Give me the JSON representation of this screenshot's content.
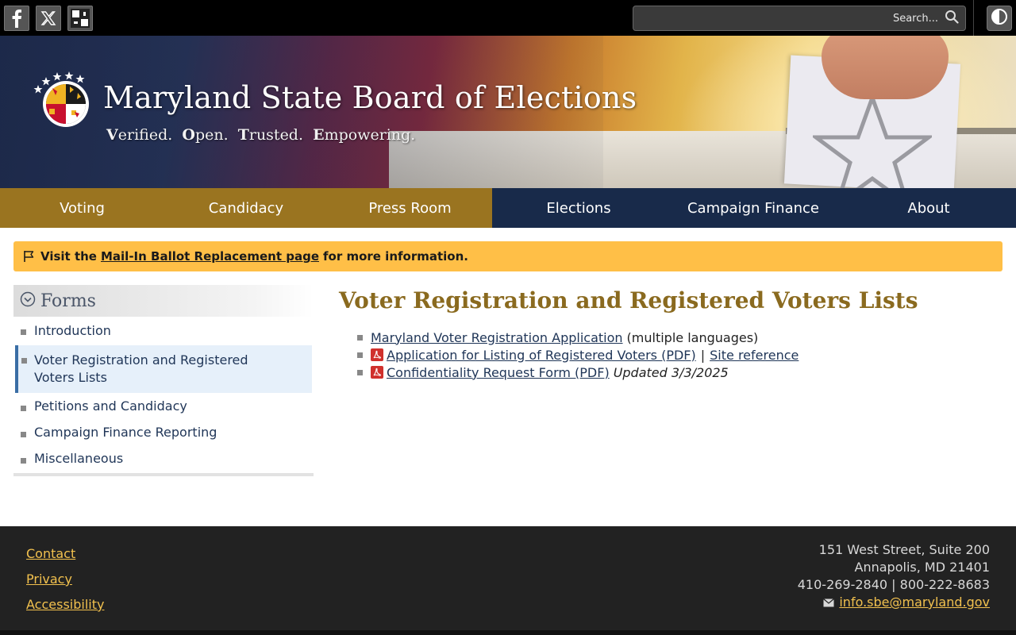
{
  "topbar": {
    "social": [
      "facebook-icon",
      "x-icon",
      "maryland-flag-icon"
    ],
    "search": {
      "placeholder": "Search..."
    },
    "contrast_icon": "contrast-icon"
  },
  "header": {
    "title": "Maryland State Board of Elections",
    "tagline": [
      {
        "initial": "V",
        "rest": "erified."
      },
      {
        "initial": "O",
        "rest": "pen."
      },
      {
        "initial": "T",
        "rest": "rusted."
      },
      {
        "initial": "E",
        "rest": "mpowering."
      }
    ]
  },
  "nav": {
    "items": [
      {
        "label": "Voting",
        "group": "gold"
      },
      {
        "label": "Candidacy",
        "group": "gold"
      },
      {
        "label": "Press Room",
        "group": "gold"
      },
      {
        "label": "Elections",
        "group": "navy"
      },
      {
        "label": "Campaign Finance",
        "group": "navy"
      },
      {
        "label": "About",
        "group": "navy"
      }
    ]
  },
  "alert": {
    "prefix": "Visit the",
    "link": "Mail-In Ballot Replacement page",
    "suffix": "for more information."
  },
  "sidebar": {
    "heading": "Forms",
    "items": [
      {
        "label": "Introduction",
        "active": false
      },
      {
        "label": "Voter Registration and Registered Voters Lists",
        "active": true
      },
      {
        "label": "Petitions and Candidacy",
        "active": false
      },
      {
        "label": "Campaign Finance Reporting",
        "active": false
      },
      {
        "label": "Miscellaneous",
        "active": false
      }
    ]
  },
  "main": {
    "title": "Voter Registration and Registered Voters Lists",
    "documents": [
      {
        "link": "Maryland Voter Registration Application",
        "pdf": false,
        "note": "(multiple languages)"
      },
      {
        "link": "Application for Listing of Registered Voters (PDF)",
        "pdf": true,
        "separator": "|",
        "extra_link": "Site reference"
      },
      {
        "link": "Confidentiality Request Form (PDF)",
        "pdf": true,
        "italic_note": "Updated 3/3/2025"
      }
    ]
  },
  "footer": {
    "links": [
      "Contact",
      "Privacy",
      "Accessibility"
    ],
    "address": [
      "151 West Street, Suite 200",
      "Annapolis, MD 21401",
      "410-269-2840 | 800-222-8683"
    ],
    "email": "info.sbe@maryland.gov"
  },
  "colors": {
    "nav_gold": "#9a7420",
    "nav_navy": "#182a4a",
    "alert_bg": "#ffbf47",
    "title_gold": "#8a6a1f",
    "link_navy": "#1f3557",
    "footer_link": "#f2c14e"
  }
}
